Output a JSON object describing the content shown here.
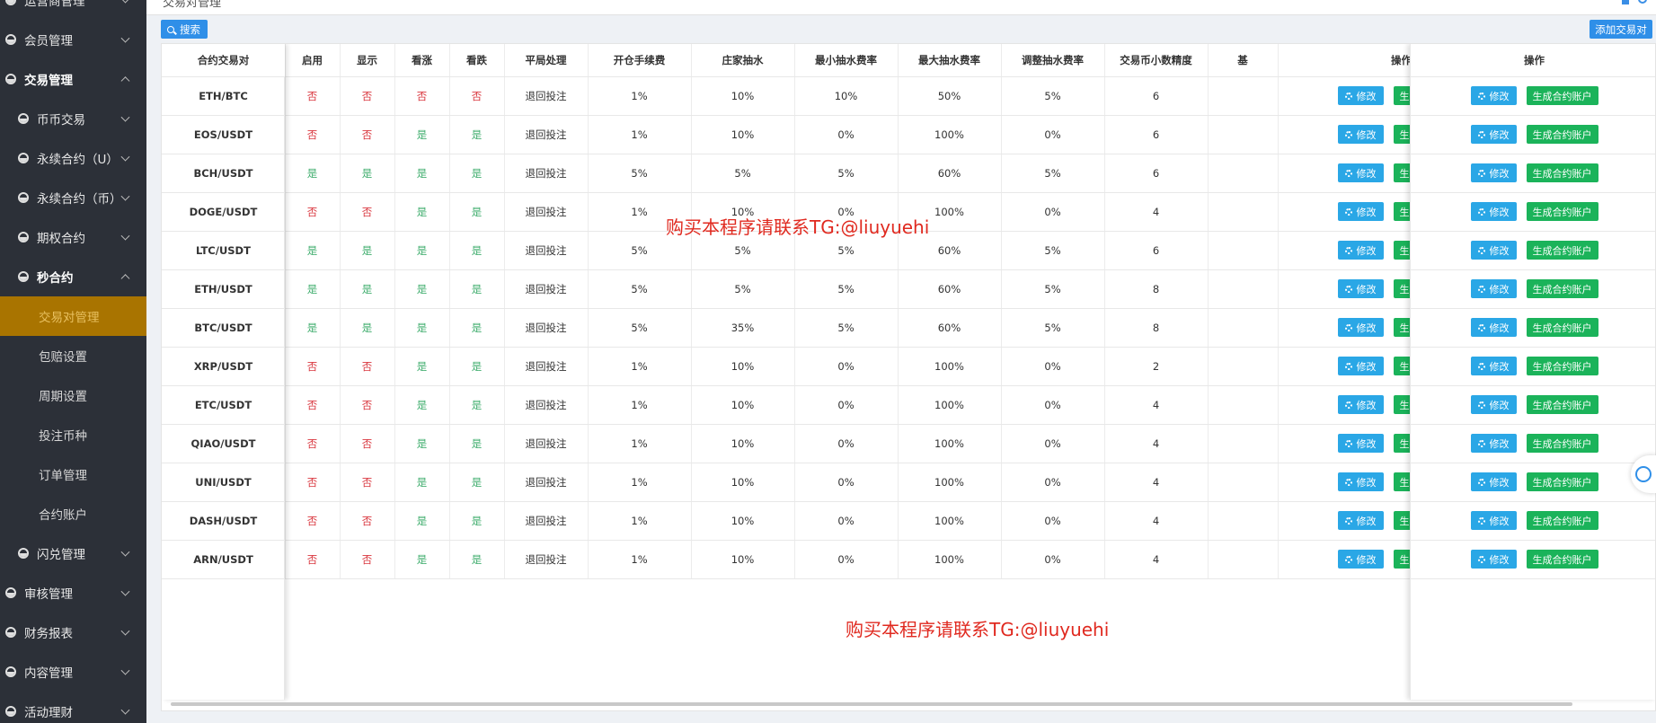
{
  "topbar": {
    "breadcrumb": "交易对管理"
  },
  "sidebar": {
    "items": [
      {
        "label": "运营商管理",
        "type": "group",
        "chevron": "down"
      },
      {
        "label": "会员管理",
        "type": "group",
        "chevron": "down"
      },
      {
        "label": "交易管理",
        "type": "group",
        "chevron": "up",
        "active": true
      },
      {
        "label": "币币交易",
        "type": "sub",
        "chevron": "down"
      },
      {
        "label": "永续合约（U）",
        "type": "sub",
        "chevron": "down"
      },
      {
        "label": "永续合约（币）",
        "type": "sub",
        "chevron": "down"
      },
      {
        "label": "期权合约",
        "type": "sub",
        "chevron": "down"
      },
      {
        "label": "秒合约",
        "type": "sub",
        "chevron": "up",
        "active": true
      },
      {
        "label": "交易对管理",
        "type": "leaf",
        "selected": true
      },
      {
        "label": "包赔设置",
        "type": "leaf"
      },
      {
        "label": "周期设置",
        "type": "leaf"
      },
      {
        "label": "投注币种",
        "type": "leaf"
      },
      {
        "label": "订单管理",
        "type": "leaf"
      },
      {
        "label": "合约账户",
        "type": "leaf"
      },
      {
        "label": "闪兑管理",
        "type": "sub",
        "chevron": "down"
      },
      {
        "label": "审核管理",
        "type": "group",
        "chevron": "down"
      },
      {
        "label": "财务报表",
        "type": "group",
        "chevron": "down"
      },
      {
        "label": "内容管理",
        "type": "group",
        "chevron": "down"
      },
      {
        "label": "活动理财",
        "type": "group",
        "chevron": "down"
      }
    ]
  },
  "toolbar": {
    "search_label": "搜索",
    "add_label": "添加交易对"
  },
  "table": {
    "columns": [
      "合约交易对",
      "启用",
      "显示",
      "看涨",
      "看跌",
      "平局处理",
      "开仓手续费",
      "庄家抽水",
      "最小抽水费率",
      "最大抽水费率",
      "调整抽水费率",
      "交易币小数精度",
      "基",
      "操作"
    ],
    "rows": [
      [
        "ETH/BTC",
        "否",
        "否",
        "否",
        "否",
        "退回投注",
        "1%",
        "10%",
        "10%",
        "50%",
        "5%",
        "6"
      ],
      [
        "EOS/USDT",
        "否",
        "否",
        "是",
        "是",
        "退回投注",
        "1%",
        "10%",
        "0%",
        "100%",
        "0%",
        "6"
      ],
      [
        "BCH/USDT",
        "是",
        "是",
        "是",
        "是",
        "退回投注",
        "5%",
        "5%",
        "5%",
        "60%",
        "5%",
        "6"
      ],
      [
        "DOGE/USDT",
        "否",
        "否",
        "是",
        "是",
        "退回投注",
        "1%",
        "10%",
        "0%",
        "100%",
        "0%",
        "4"
      ],
      [
        "LTC/USDT",
        "是",
        "是",
        "是",
        "是",
        "退回投注",
        "5%",
        "5%",
        "5%",
        "60%",
        "5%",
        "6"
      ],
      [
        "ETH/USDT",
        "是",
        "是",
        "是",
        "是",
        "退回投注",
        "5%",
        "5%",
        "5%",
        "60%",
        "5%",
        "8"
      ],
      [
        "BTC/USDT",
        "是",
        "是",
        "是",
        "是",
        "退回投注",
        "5%",
        "35%",
        "5%",
        "60%",
        "5%",
        "8"
      ],
      [
        "XRP/USDT",
        "否",
        "否",
        "是",
        "是",
        "退回投注",
        "1%",
        "10%",
        "0%",
        "100%",
        "0%",
        "2"
      ],
      [
        "ETC/USDT",
        "否",
        "否",
        "是",
        "是",
        "退回投注",
        "1%",
        "10%",
        "0%",
        "100%",
        "0%",
        "4"
      ],
      [
        "QIAO/USDT",
        "否",
        "否",
        "是",
        "是",
        "退回投注",
        "1%",
        "10%",
        "0%",
        "100%",
        "0%",
        "4"
      ],
      [
        "UNI/USDT",
        "否",
        "否",
        "是",
        "是",
        "退回投注",
        "1%",
        "10%",
        "0%",
        "100%",
        "0%",
        "4"
      ],
      [
        "DASH/USDT",
        "否",
        "否",
        "是",
        "是",
        "退回投注",
        "1%",
        "10%",
        "0%",
        "100%",
        "0%",
        "4"
      ],
      [
        "ARN/USDT",
        "否",
        "否",
        "是",
        "是",
        "退回投注",
        "1%",
        "10%",
        "0%",
        "100%",
        "0%",
        "4"
      ]
    ],
    "edit_label": "修改",
    "gen_label": "生成合约账户"
  },
  "watermark": {
    "text": "购买本程序请联系TG:@liuyuehi"
  },
  "colors": {
    "sidebar_bg": "#2c3038",
    "selected_bg": "#a97400",
    "primary": "#2f8fe8",
    "success": "#1bb35a",
    "no": "#d9363e",
    "yes": "#3bab6a"
  }
}
